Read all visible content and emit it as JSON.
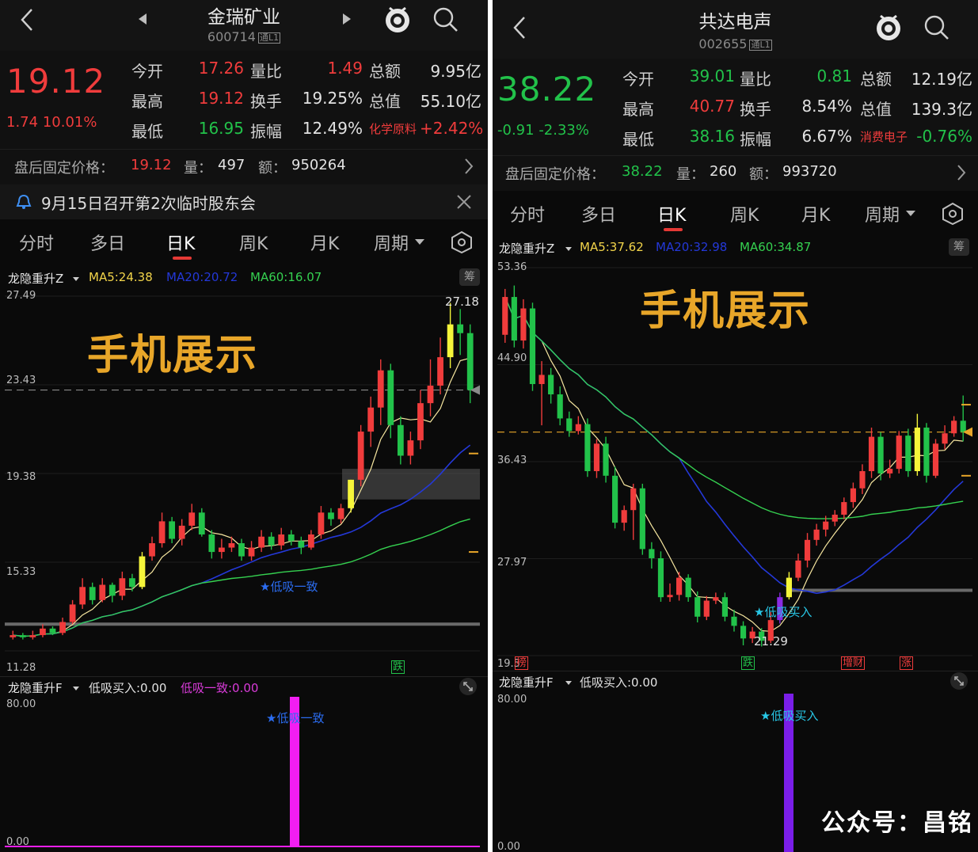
{
  "watermark_text": "手机展示",
  "footer": "公众号：昌铭",
  "colors": {
    "up": "#f03c3c",
    "down": "#22c24a",
    "ma5": "#f2d44a",
    "ma20": "#2438d8",
    "ma60": "#35d150",
    "accent": "#e8a629"
  },
  "left": {
    "name": "金瑞矿业",
    "code": "600714",
    "tag": "通L1",
    "price": "19.12",
    "change": "1.74",
    "change_pct": "10.01%",
    "quote": {
      "open_label": "今开",
      "open": "17.26",
      "high_label": "最高",
      "high": "19.12",
      "low_label": "最低",
      "low": "16.95",
      "vr_label": "量比",
      "vr": "1.49",
      "turnover_label": "换手",
      "turnover": "19.25%",
      "amp_label": "振幅",
      "amp": "12.49%",
      "amount_label": "总额",
      "amount": "9.95亿",
      "mcap_label": "总值",
      "mcap": "55.10亿",
      "sector": "化学原料",
      "sector_chg": "+2.42%"
    },
    "after": {
      "label": "盘后固定价格：",
      "price": "19.12",
      "vol_label": "量：",
      "vol": "497",
      "amt_label": "额：",
      "amt": "950264"
    },
    "notice": "9月15日召开第2次临时股东会",
    "tabs": [
      "分时",
      "多日",
      "日K",
      "周K",
      "月K",
      "周期"
    ],
    "active_tab": "日K",
    "indicator": {
      "name": "龙隐重升Z",
      "ma5": "MA5:24.38",
      "ma20": "MA20:20.72",
      "ma60": "MA60:16.07"
    },
    "chip": "筹",
    "axis": [
      "27.49",
      "23.43",
      "19.38",
      "15.33",
      "11.28"
    ],
    "high_label": "27.18",
    "signal": "★低吸一致",
    "mark": "跌",
    "sub": {
      "name": "龙隐重升F",
      "label1": "低吸买入:0.00",
      "label2": "低吸一致:0.00",
      "top": "80.00",
      "bottom": "0.00",
      "signal": "★低吸一致"
    }
  },
  "right": {
    "name": "共达电声",
    "code": "002655",
    "tag": "通L1",
    "price": "38.22",
    "change": "-0.91",
    "change_pct": "-2.33%",
    "quote": {
      "open_label": "今开",
      "open": "39.01",
      "high_label": "最高",
      "high": "40.77",
      "low_label": "最低",
      "low": "38.16",
      "vr_label": "量比",
      "vr": "0.81",
      "turnover_label": "换手",
      "turnover": "8.54%",
      "amp_label": "振幅",
      "amp": "6.67%",
      "amount_label": "总额",
      "amount": "12.19亿",
      "mcap_label": "总值",
      "mcap": "139.3亿",
      "sector": "消费电子",
      "sector_chg": "-0.76%"
    },
    "after": {
      "label": "盘后固定价格：",
      "price": "38.22",
      "vol_label": "量：",
      "vol": "260",
      "amt_label": "额：",
      "amt": "993720"
    },
    "tabs": [
      "分时",
      "多日",
      "日K",
      "周K",
      "月K",
      "周期"
    ],
    "active_tab": "日K",
    "indicator": {
      "name": "龙隐重升Z",
      "ma5": "MA5:37.62",
      "ma20": "MA20:32.98",
      "ma60": "MA60:34.87"
    },
    "chip": "筹",
    "axis": [
      "53.36",
      "44.90",
      "36.43",
      "27.97",
      "19.5"
    ],
    "low_label": "21.29",
    "signal": "★低吸买入",
    "marks": [
      "榜",
      "跌",
      "增财",
      "涨"
    ],
    "sub": {
      "name": "龙隐重升F",
      "label1": "低吸买入:0.00",
      "top": "80.00",
      "bottom": "0.00",
      "signal": "★低吸买入"
    }
  },
  "chart_data": [
    {
      "type": "candlestick",
      "stock": "金瑞矿业",
      "ylim": [
        11.28,
        27.49
      ],
      "series": [
        {
          "name": "MA5",
          "value": 24.38
        },
        {
          "name": "MA20",
          "value": 20.72
        },
        {
          "name": "MA60",
          "value": 16.07
        }
      ],
      "candles": [
        [
          11.9,
          12.0,
          12.2,
          11.8
        ],
        [
          12.0,
          11.9,
          12.1,
          11.8
        ],
        [
          11.9,
          12.0,
          12.2,
          11.8
        ],
        [
          12.0,
          12.3,
          12.5,
          11.9
        ],
        [
          12.3,
          12.1,
          12.4,
          12.0
        ],
        [
          12.1,
          12.6,
          12.8,
          12.0
        ],
        [
          12.6,
          13.4,
          13.6,
          12.5
        ],
        [
          13.4,
          14.2,
          14.6,
          13.2
        ],
        [
          14.2,
          13.6,
          14.4,
          13.4
        ],
        [
          13.6,
          14.3,
          14.6,
          13.5
        ],
        [
          14.3,
          13.8,
          14.4,
          13.5
        ],
        [
          13.8,
          14.6,
          14.9,
          13.6
        ],
        [
          14.6,
          14.2,
          14.8,
          14.0
        ],
        [
          14.2,
          15.6,
          15.8,
          14.1
        ],
        [
          15.6,
          16.2,
          16.5,
          15.4
        ],
        [
          16.2,
          17.2,
          17.6,
          16.0
        ],
        [
          17.2,
          16.4,
          17.4,
          16.2
        ],
        [
          16.4,
          17.0,
          17.3,
          16.1
        ],
        [
          17.0,
          17.6,
          18.0,
          16.8
        ],
        [
          17.6,
          16.6,
          17.8,
          16.5
        ],
        [
          16.6,
          15.8,
          16.8,
          15.5
        ],
        [
          15.8,
          16.0,
          16.4,
          15.5
        ],
        [
          16.0,
          16.2,
          16.5,
          15.8
        ],
        [
          16.2,
          15.6,
          16.4,
          15.4
        ],
        [
          15.6,
          16.0,
          16.3,
          15.4
        ],
        [
          16.0,
          16.5,
          16.8,
          15.8
        ],
        [
          16.5,
          16.1,
          16.7,
          15.9
        ],
        [
          16.1,
          16.6,
          16.9,
          15.9
        ],
        [
          16.6,
          16.3,
          16.8,
          16.1
        ],
        [
          16.3,
          16.0,
          16.5,
          15.7
        ],
        [
          16.0,
          16.6,
          16.8,
          15.9
        ],
        [
          16.6,
          17.6,
          17.9,
          16.4
        ],
        [
          17.6,
          17.3,
          17.8,
          17.0
        ],
        [
          17.3,
          17.8,
          18.0,
          17.1
        ],
        [
          17.8,
          19.1,
          19.1,
          17.6
        ],
        [
          19.1,
          21.3,
          21.6,
          18.8
        ],
        [
          21.3,
          22.4,
          22.9,
          20.6
        ],
        [
          22.4,
          24.1,
          24.6,
          21.6
        ],
        [
          24.1,
          21.6,
          24.4,
          21.0
        ],
        [
          21.6,
          20.2,
          22.0,
          19.8
        ],
        [
          20.2,
          20.9,
          21.3,
          19.8
        ],
        [
          20.9,
          22.6,
          23.2,
          20.5
        ],
        [
          22.6,
          23.4,
          24.6,
          22.0
        ],
        [
          23.4,
          24.7,
          25.6,
          23.0
        ],
        [
          24.7,
          26.2,
          27.18,
          24.2
        ],
        [
          26.2,
          25.8,
          26.9,
          24.8
        ],
        [
          25.8,
          23.2,
          26.2,
          22.6
        ]
      ]
    },
    {
      "type": "candlestick",
      "stock": "共达电声",
      "ylim": [
        19.5,
        53.36
      ],
      "series": [
        {
          "name": "MA5",
          "value": 37.62
        },
        {
          "name": "MA20",
          "value": 32.98
        },
        {
          "name": "MA60",
          "value": 34.87
        }
      ],
      "candles": [
        [
          47.5,
          50.8,
          51.5,
          46.8
        ],
        [
          50.8,
          47.0,
          51.8,
          46.4
        ],
        [
          47.0,
          49.8,
          50.6,
          46.3
        ],
        [
          49.8,
          43.2,
          50.3,
          42.6
        ],
        [
          43.2,
          44.0,
          45.2,
          39.6
        ],
        [
          44.0,
          42.3,
          44.6,
          41.5
        ],
        [
          42.3,
          40.2,
          43.0,
          39.6
        ],
        [
          40.2,
          39.1,
          40.8,
          38.6
        ],
        [
          39.1,
          39.7,
          40.4,
          38.8
        ],
        [
          39.7,
          35.6,
          40.2,
          35.1
        ],
        [
          35.6,
          38.0,
          38.4,
          35.0
        ],
        [
          38.0,
          35.2,
          38.6,
          34.6
        ],
        [
          35.2,
          31.1,
          36.0,
          30.6
        ],
        [
          31.1,
          32.2,
          32.6,
          30.4
        ],
        [
          32.2,
          34.1,
          34.5,
          29.6
        ],
        [
          34.1,
          28.8,
          34.5,
          28.3
        ],
        [
          28.8,
          28.0,
          29.4,
          27.1
        ],
        [
          28.0,
          24.6,
          28.6,
          24.2
        ],
        [
          24.6,
          24.8,
          25.8,
          24.2
        ],
        [
          24.8,
          26.3,
          26.8,
          24.3
        ],
        [
          26.3,
          24.6,
          26.6,
          24.2
        ],
        [
          24.6,
          22.9,
          25.1,
          22.4
        ],
        [
          22.9,
          24.3,
          24.7,
          22.6
        ],
        [
          24.3,
          24.6,
          25.0,
          24.0
        ],
        [
          24.6,
          22.9,
          25.0,
          22.5
        ],
        [
          22.9,
          22.1,
          23.5,
          21.6
        ],
        [
          22.1,
          21.0,
          22.5,
          20.4
        ],
        [
          21.0,
          21.6,
          22.0,
          20.6
        ],
        [
          21.6,
          20.8,
          21.9,
          20.3
        ],
        [
          20.8,
          22.6,
          23.3,
          20.6
        ],
        [
          22.6,
          24.6,
          25.0,
          22.3
        ],
        [
          24.6,
          26.3,
          26.8,
          24.4
        ],
        [
          26.3,
          27.8,
          28.4,
          26.0
        ],
        [
          27.8,
          29.6,
          30.2,
          27.2
        ],
        [
          29.6,
          30.5,
          31.0,
          29.1
        ],
        [
          30.5,
          31.2,
          31.7,
          29.9
        ],
        [
          31.2,
          31.8,
          32.2,
          30.8
        ],
        [
          31.8,
          32.9,
          33.3,
          31.4
        ],
        [
          32.9,
          34.1,
          34.6,
          32.4
        ],
        [
          34.1,
          35.6,
          36.2,
          33.6
        ],
        [
          35.6,
          38.6,
          39.4,
          35.0
        ],
        [
          38.6,
          35.4,
          39.0,
          34.8
        ],
        [
          35.4,
          35.8,
          36.6,
          35.0
        ],
        [
          35.8,
          38.7,
          39.1,
          35.4
        ],
        [
          38.7,
          35.6,
          39.3,
          35.1
        ],
        [
          35.6,
          39.4,
          40.6,
          35.2
        ],
        [
          39.4,
          35.2,
          39.8,
          34.6
        ],
        [
          35.2,
          38.0,
          38.4,
          35.0
        ],
        [
          38.0,
          38.9,
          39.6,
          37.5
        ],
        [
          38.9,
          40.0,
          40.4,
          38.6
        ],
        [
          40.0,
          39.01,
          42.2,
          38.2
        ]
      ]
    }
  ]
}
